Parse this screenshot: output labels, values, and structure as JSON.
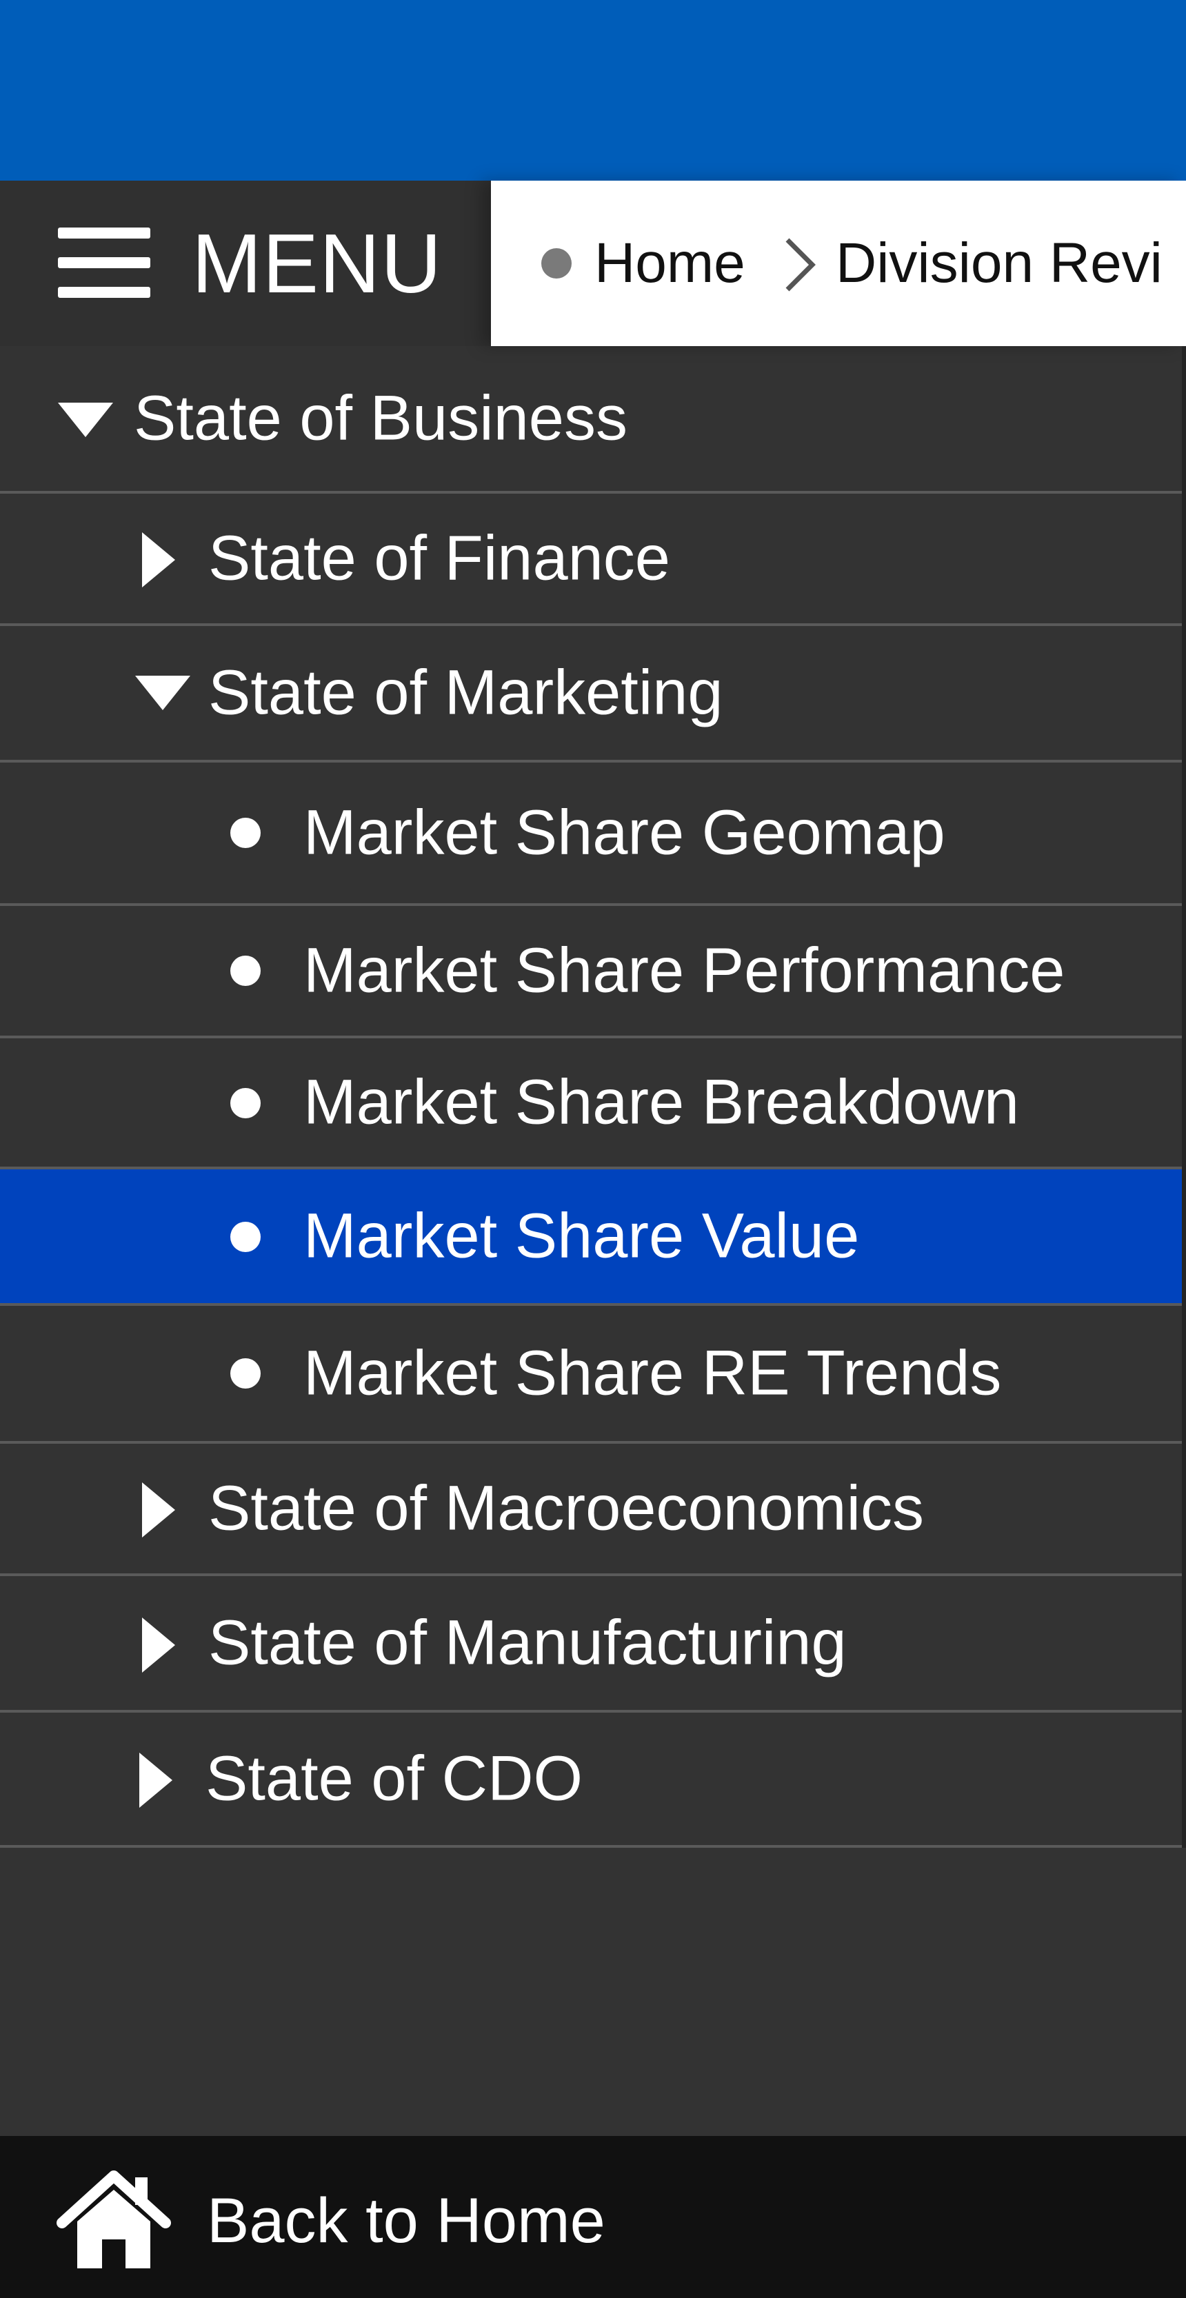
{
  "header": {
    "menu_label": "MENU"
  },
  "breadcrumb": {
    "home": "Home",
    "current": "Division Revi"
  },
  "nav": {
    "section": "State of Business",
    "items": [
      {
        "label": "State of Finance"
      },
      {
        "label": "State of Marketing"
      },
      {
        "label": "Market Share Geomap"
      },
      {
        "label": "Market Share Performance"
      },
      {
        "label": "Market Share Breakdown"
      },
      {
        "label": "Market Share Value"
      },
      {
        "label": "Market Share RE Trends"
      },
      {
        "label": "State of Macroeconomics"
      },
      {
        "label": "State of Manufacturing"
      },
      {
        "label": "State of CDO"
      }
    ]
  },
  "footer": {
    "back_label": "Back to Home"
  },
  "colors": {
    "topbar": "#005db9",
    "active": "#0043bd",
    "sidebar": "#333333",
    "footer": "#111111"
  },
  "icons": {
    "menu": "hamburger-icon",
    "home": "house-icon",
    "expanded": "caret-down-icon",
    "collapsed": "caret-right-icon",
    "leaf": "bullet-icon"
  }
}
